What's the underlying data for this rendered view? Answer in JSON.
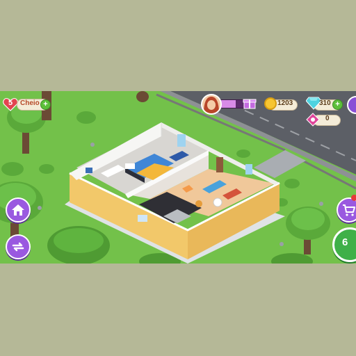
{
  "hud": {
    "level": "5",
    "energy_label": "Cheio",
    "xp_progress": 0.6,
    "coins": "1203",
    "gems": "310",
    "tickets": "0"
  },
  "buttons": {
    "play_count": "6"
  },
  "colors": {
    "grass": "#73c14a",
    "road": "#5a5d63",
    "wall_exterior": "#f2c86a",
    "floor_bedroom": "#d8d6d2",
    "floor_living": "#f0c89a",
    "purple_button": "#9a59e0",
    "green_button": "#3fb048"
  },
  "icons": [
    "heart-icon",
    "plus-icon",
    "gift-icon",
    "coin-icon",
    "gem-icon",
    "ticket-icon",
    "settings-icon",
    "home-icon",
    "swap-icon",
    "cart-icon"
  ]
}
